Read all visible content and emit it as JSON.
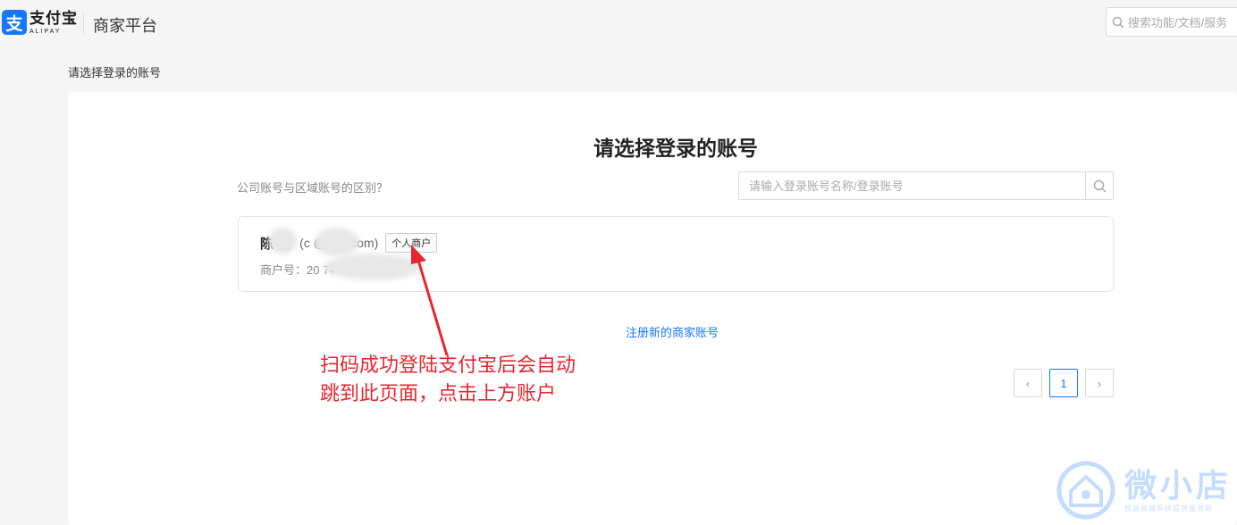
{
  "header": {
    "logo_cn": "支付宝",
    "logo_en": "ALIPAY",
    "platform_title": "商家平台",
    "search_placeholder": "搜索功能/文档/服务"
  },
  "breadcrumb": "请选择登录的账号",
  "main": {
    "title": "请选择登录的账号",
    "difference_link": "公司账号与区域账号的区别？",
    "search_placeholder": "请输入登录账号名称/登录账号",
    "account": {
      "name": "陈  鹏",
      "email": "(c           @163.com)",
      "tag": "个人商户",
      "merchant_label": "商户号：20              74"
    },
    "register_link": "注册新的商家账号",
    "pagination": {
      "prev": "‹",
      "current": "1",
      "next": "›"
    }
  },
  "annotation": {
    "line1": "扫码成功登陆支付宝后会自动",
    "line2": "跳到此页面，点击上方账户"
  },
  "watermark": {
    "name": "微小店",
    "subtitle": "权益商城系统提供服务商"
  },
  "colors": {
    "brand": "#1677ff",
    "annotation": "#e8262f"
  }
}
